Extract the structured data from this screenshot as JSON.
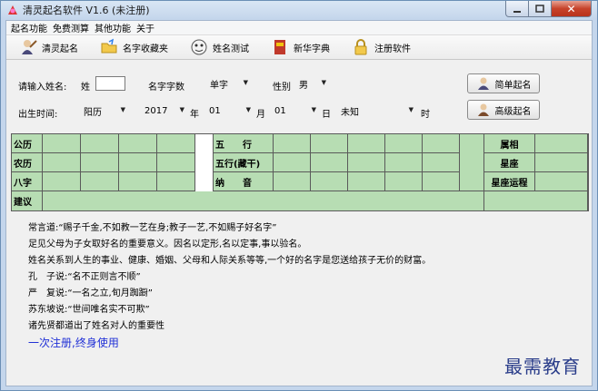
{
  "window": {
    "title": "清灵起名软件 V1.6 (未注册)",
    "accent": "#c4d6ec"
  },
  "menu": [
    "起名功能",
    "免费测算",
    "其他功能",
    "关于"
  ],
  "toolbar": [
    {
      "label": "清灵起名",
      "icon": "scholar-icon"
    },
    {
      "label": "名字收藏夹",
      "icon": "folder-icon"
    },
    {
      "label": "姓名测试",
      "icon": "face-icon"
    },
    {
      "label": "新华字典",
      "icon": "dictionary-icon"
    },
    {
      "label": "注册软件",
      "icon": "lock-icon"
    }
  ],
  "form": {
    "name_prompt": "请输入姓名:",
    "surname_label": "姓",
    "surname_value": "",
    "name_length_label": "名字字数",
    "name_length_value": "单字",
    "gender_label": "性别",
    "gender_value": "男",
    "birth_label": "出生时间:",
    "calendar_value": "阳历",
    "year_value": "2017",
    "year_unit": "年",
    "month_value": "01",
    "month_unit": "月",
    "day_value": "01",
    "day_unit": "日",
    "hour_value": "未知",
    "hour_unit": "时"
  },
  "buttons": {
    "simple": "简单起名",
    "advanced": "高级起名"
  },
  "grid": {
    "fill": "#b7ddb3",
    "row_labels": [
      "公历",
      "农历",
      "八字",
      "建议"
    ],
    "mid_labels": [
      "五　　行",
      "五行(藏干)",
      "纳　　音"
    ],
    "right_labels": [
      "属相",
      "星座",
      "星座运程"
    ]
  },
  "text_lines": [
    "常言道:“赐子千金,不如教一艺在身;教子一艺,不如赐子好名字”",
    "足见父母为子女取好名的重要意义。因名以定形,名以定事,事以验名。",
    "姓名关系到人生的事业、健康、婚姻、父母和人际关系等等,一个好的名字是您送给孩子无价的财富。",
    "孔　子说:“名不正则言不顺”",
    "严　复说:“一名之立,旬月踟蹰”",
    "苏东坡说:“世间唯名实不可欺”",
    "诸先贤都道出了姓名对人的重要性"
  ],
  "slogan": "一次注册,终身使用",
  "watermark": "最需教育"
}
